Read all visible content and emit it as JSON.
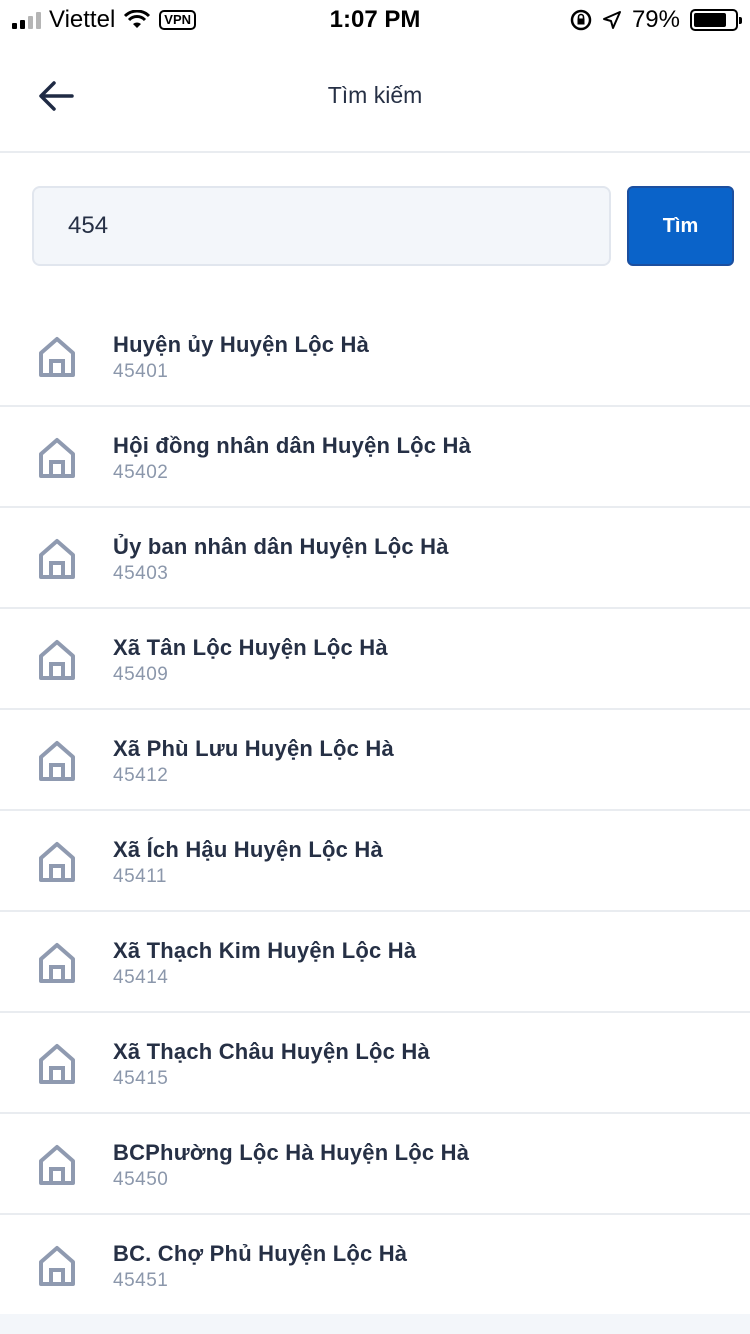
{
  "status_bar": {
    "carrier": "Viettel",
    "vpn": "VPN",
    "time": "1:07 PM",
    "battery": "79%",
    "battery_level": 0.79,
    "icons": [
      "signal-icon",
      "wifi-icon",
      "rotation-lock-icon",
      "location-icon",
      "battery-icon"
    ]
  },
  "header": {
    "title": "Tìm kiếm",
    "back_icon": "arrow-left-icon"
  },
  "search": {
    "value": "454",
    "button_label": "Tìm"
  },
  "results": [
    {
      "name": "Huyện ủy Huyện Lộc Hà",
      "code": "45401"
    },
    {
      "name": "Hội đồng nhân dân Huyện Lộc Hà",
      "code": "45402"
    },
    {
      "name": "Ủy ban nhân dân Huyện Lộc Hà",
      "code": "45403"
    },
    {
      "name": "Xã Tân Lộc Huyện Lộc Hà",
      "code": "45409"
    },
    {
      "name": "Xã Phù Lưu Huyện Lộc Hà",
      "code": "45412"
    },
    {
      "name": "Xã Ích Hậu Huyện Lộc Hà",
      "code": "45411"
    },
    {
      "name": "Xã Thạch Kim Huyện Lộc Hà",
      "code": "45414"
    },
    {
      "name": "Xã Thạch Châu Huyện Lộc Hà",
      "code": "45415"
    },
    {
      "name": "BCPhường Lộc Hà Huyện Lộc Hà",
      "code": "45450"
    },
    {
      "name": "BC. Chợ Phủ Huyện Lộc Hà",
      "code": "45451"
    }
  ],
  "colors": {
    "accent": "#0a63c9",
    "text": "#263045",
    "subtext": "#8b97ab",
    "icon": "#8f9ab0"
  }
}
